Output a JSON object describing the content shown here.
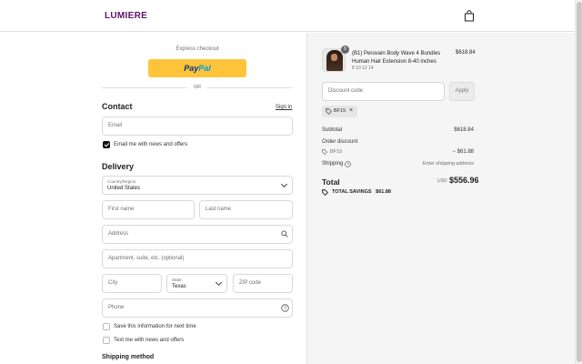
{
  "header": {
    "logo": "LUMIERE",
    "cart_icon": "shopping-bag-icon"
  },
  "express": {
    "label": "Express checkout",
    "paypal_part1": "Pay",
    "paypal_part2": "Pal",
    "or_label": "OR"
  },
  "contact": {
    "heading": "Contact",
    "signin_label": "Sign in",
    "email_placeholder": "Email",
    "newsletter_label": "Email me with news and offers",
    "newsletter_checked": true
  },
  "delivery": {
    "heading": "Delivery",
    "country_label": "Country/Region",
    "country_value": "United States",
    "first_name_placeholder": "First name",
    "last_name_placeholder": "Last name",
    "address_placeholder": "Address",
    "apartment_placeholder": "Apartment, suite, etc. (optional)",
    "city_placeholder": "City",
    "state_label": "State",
    "state_value": "Texas",
    "zip_placeholder": "ZIP code",
    "phone_placeholder": "Phone",
    "save_info_label": "Save this information for next time",
    "text_me_label": "Text me with news and offers"
  },
  "shipping_method": {
    "heading": "Shipping method"
  },
  "summary": {
    "product": {
      "quantity": "8",
      "title": "(B1) Peruvain Body Wave 4 Bundles Human Hair Extension 8-40 inches",
      "variant": "8 10 12 14",
      "price": "$618.84"
    },
    "discount_placeholder": "Discount code",
    "apply_label": "Apply",
    "applied_code": "BF15",
    "subtotal_label": "Subtotal",
    "subtotal_value": "$618.84",
    "order_discount_label": "Order discount",
    "discount_code": "BF15",
    "discount_value": "− $61.88",
    "shipping_label": "Shipping",
    "shipping_value": "Enter shipping address",
    "total_label": "Total",
    "currency": "USD",
    "total_value": "$556.96",
    "savings_label": "TOTAL SAVINGS",
    "savings_value": "$61.88"
  },
  "colors": {
    "brand": "#5a1466",
    "paypal": "#ffc439",
    "panel": "#f5f5f5"
  }
}
